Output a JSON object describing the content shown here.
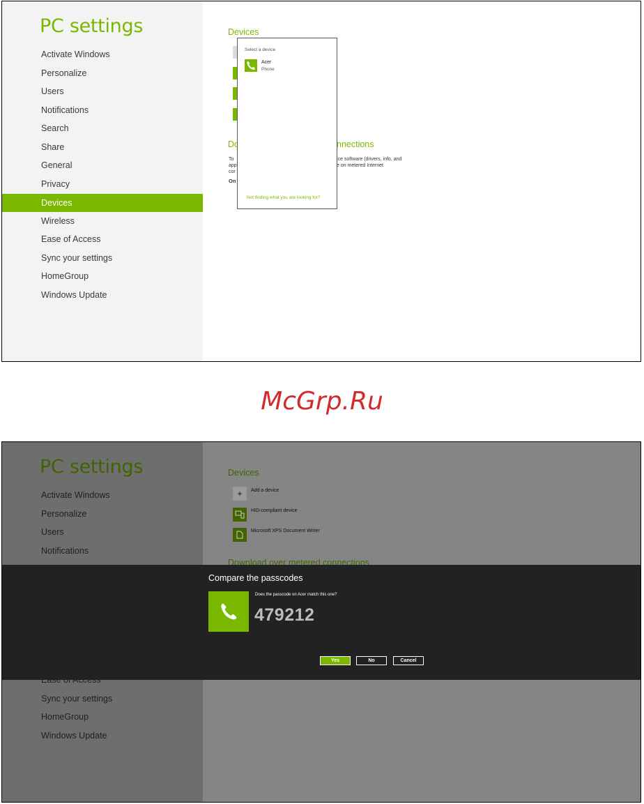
{
  "watermark": "McGrp.Ru",
  "colors": {
    "accent": "#7ab800",
    "dialog_bg": "#222222"
  },
  "screen1": {
    "title": "PC settings",
    "nav": [
      "Activate Windows",
      "Personalize",
      "Users",
      "Notifications",
      "Search",
      "Share",
      "General",
      "Privacy",
      "Devices",
      "Wireless",
      "Ease of Access",
      "Sync your settings",
      "HomeGroup",
      "Windows Update"
    ],
    "active_nav": "Devices",
    "devices_heading": "Devices",
    "metered_heading_start": "Do",
    "metered_heading_end": "nnections",
    "metered_text_left": [
      "To",
      "app",
      "cor"
    ],
    "metered_text_right": [
      "ice software (drivers, info, and",
      "e on metered Internet"
    ],
    "toggle_label": "On",
    "picker": {
      "title": "Select a device",
      "item_name": "Acer",
      "item_type": "Phone",
      "item_icon": "phone-icon",
      "link": "Not finding what you are looking for?"
    }
  },
  "screen2": {
    "title": "PC settings",
    "nav_top": [
      "Activate Windows",
      "Personalize",
      "Users",
      "Notifications"
    ],
    "nav_bottom_partial": "Ease of Access",
    "nav_bottom": [
      "Sync your settings",
      "HomeGroup",
      "Windows Update"
    ],
    "devices_heading": "Devices",
    "devices": [
      {
        "label": "Add a device",
        "icon": "plus-icon"
      },
      {
        "label": "HID-compliant device",
        "icon": "hid-device-icon"
      },
      {
        "label": "Microsoft XPS Document Writer",
        "icon": "printer-doc-icon"
      }
    ],
    "metered_heading": "Download over metered connections",
    "dialog": {
      "title": "Compare the passcodes",
      "question": "Does the passcode on Acer match this one?",
      "passcode": "479212",
      "icon": "phone-icon",
      "yes": "Yes",
      "no": "No",
      "cancel": "Cancel"
    }
  }
}
